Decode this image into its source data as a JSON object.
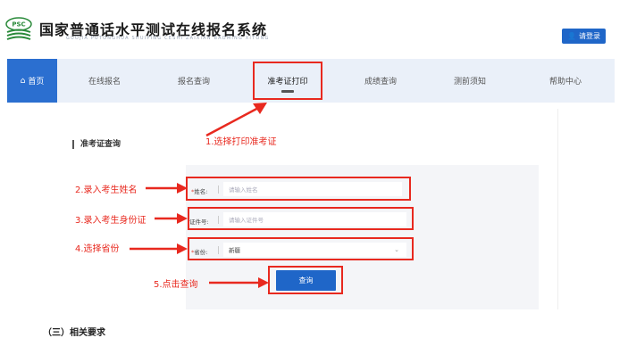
{
  "header": {
    "logo_abbr": "PSC",
    "title": "国家普通话水平测试在线报名系统",
    "subtitle": "GUOJIA PUTONGHUA SHUIPING CESHI ZAIXIAN BAOMING XITONG",
    "login_label": "请登录"
  },
  "nav": {
    "home": "首页",
    "items": [
      "在线报名",
      "报名查询",
      "准考证打印",
      "成绩查询",
      "测前须知",
      "帮助中心"
    ],
    "active": "准考证打印"
  },
  "form": {
    "section_title": "准考证查询",
    "name_label": "姓名:",
    "name_placeholder": "请输入姓名",
    "id_label": "证件号:",
    "id_placeholder": "请输入证件号",
    "province_label": "省份:",
    "province_value": "新疆",
    "query_label": "查询"
  },
  "annotations": {
    "step1": "1.选择打印准考证",
    "step2": "2.录入考生姓名",
    "step3": "3.录入考生身份证",
    "step4": "4.选择省份",
    "step5": "5.点击查询"
  },
  "footer_text": "（三）相关要求",
  "colors": {
    "brand": "#1f66c8",
    "annotation": "#e8291f",
    "nav_bg": "#eaf0f9"
  }
}
